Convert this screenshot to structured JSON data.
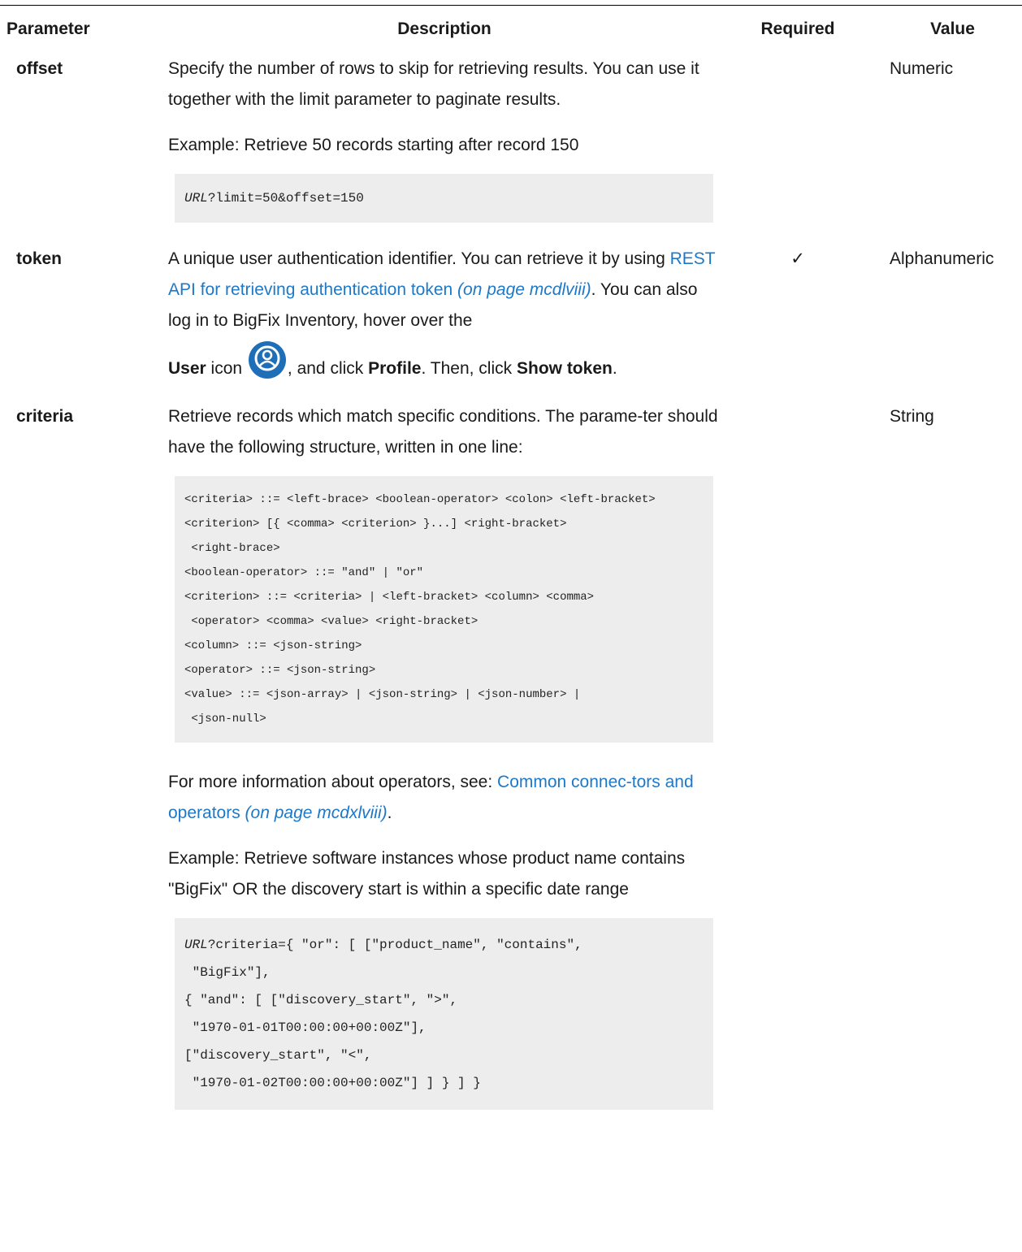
{
  "table": {
    "headers": {
      "parameter": "Parameter",
      "description": "Description",
      "required": "Required",
      "value": "Value"
    },
    "offset": {
      "name": "offset",
      "p1": "Specify the number of rows to skip for retrieving results. You can use it together with the limit parameter to paginate results.",
      "example": "Example: Retrieve 50 records starting after record 150",
      "code_url": "URL",
      "code_rest": "?limit=50&offset=150",
      "required": "",
      "value": "Numeric"
    },
    "token": {
      "name": "token",
      "t1": "A unique user authentication identifier. You can retrieve it by using ",
      "link": "REST API for retrieving authentication token",
      "link_page": " (on page mcdlviii)",
      "t2": ". You can also log in to BigFix Inventory, hover over the ",
      "user_bold": "User",
      "t3": " icon ",
      "t4": ", and click ",
      "profile_bold": "Profile",
      "t5": ". Then, click ",
      "show_token_bold": "Show token",
      "t6": ".",
      "icon": "user-icon",
      "required": "✓",
      "value": "Alphanumeric"
    },
    "criteria": {
      "name": "criteria",
      "p1": "Retrieve records which match specific conditions. The parame-ter should have the following structure, written in one line:",
      "grammar": [
        "<criteria> ::= <left-brace> <boolean-operator> <colon> <left-bracket>",
        "<criterion> [{ <comma> <criterion> }...] <right-bracket>",
        " <right-brace>",
        "<boolean-operator> ::= \"and\" | \"or\"",
        "<criterion> ::= <criteria> | <left-bracket> <column> <comma>",
        " <operator> <comma> <value> <right-bracket>",
        "<column> ::= <json-string>",
        "<operator> ::= <json-string>",
        "<value> ::= <json-array> | <json-string> | <json-number> |",
        " <json-null>"
      ],
      "ops_text": "For more information about operators, see: ",
      "ops_link": "Common connec-tors and operators",
      "ops_page": " (on page mcdxlviii)",
      "ops_end": ".",
      "example": "Example: Retrieve software instances whose product name contains \"BigFix\" OR the discovery start is within a specific date range",
      "code_url": "URL",
      "code_first": "?criteria={ \"or\": [ [\"product_name\", \"contains\",",
      "code_lines": [
        " \"BigFix\"],",
        "{ \"and\": [ [\"discovery_start\", \">\",",
        " \"1970-01-01T00:00:00+00:00Z\"],",
        "[\"discovery_start\", \"<\",",
        " \"1970-01-02T00:00:00+00:00Z\"] ] } ] }"
      ],
      "required": "",
      "value": "String"
    }
  }
}
